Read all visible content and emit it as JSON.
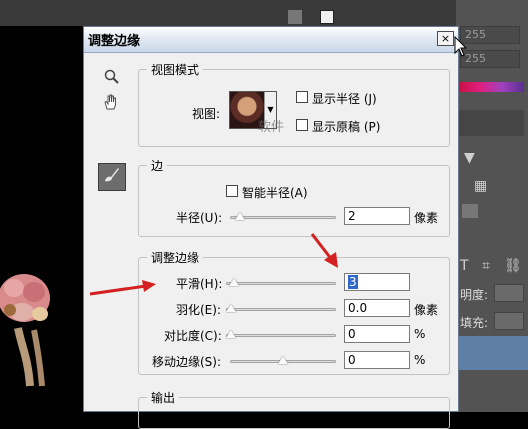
{
  "workspace": {
    "right_panel": {
      "field_1": "255",
      "field_2": "255",
      "opacity_label": "明度:",
      "fill_label": "填充:"
    },
    "colors": {
      "accent_red": "#d42020",
      "layer_highlight": "#5e7fa6"
    }
  },
  "dialog": {
    "title": "调整边缘",
    "close_icon": "×",
    "tools": {
      "zoom": "zoom-icon",
      "hand": "hand-icon",
      "brush": "refine-brush-icon"
    },
    "view_mode": {
      "legend": "视图模式",
      "view_label": "视图:",
      "show_radius": "显示半径 (J)",
      "show_original": "显示原稿 (P)"
    },
    "edge_detection": {
      "legend": "边",
      "smart_radius": "智能半径(A)",
      "radius_label": "半径(U):",
      "radius_value": "2",
      "radius_unit": "像素",
      "radius_level": 0.05
    },
    "adjust_edge": {
      "legend": "调整边缘",
      "smooth_label": "平滑(H):",
      "smooth_value": "3",
      "smooth_level": 0.03,
      "feather_label": "羽化(E):",
      "feather_value": "0.0",
      "feather_unit": "像素",
      "feather_level": 0.0,
      "contrast_label": "对比度(C):",
      "contrast_value": "0",
      "contrast_unit": "%",
      "contrast_level": 0.0,
      "shift_label": "移动边缘(S):",
      "shift_value": "0",
      "shift_unit": "%",
      "shift_level": 0.5
    },
    "output": {
      "legend": "输出"
    }
  },
  "watermark": "软件"
}
